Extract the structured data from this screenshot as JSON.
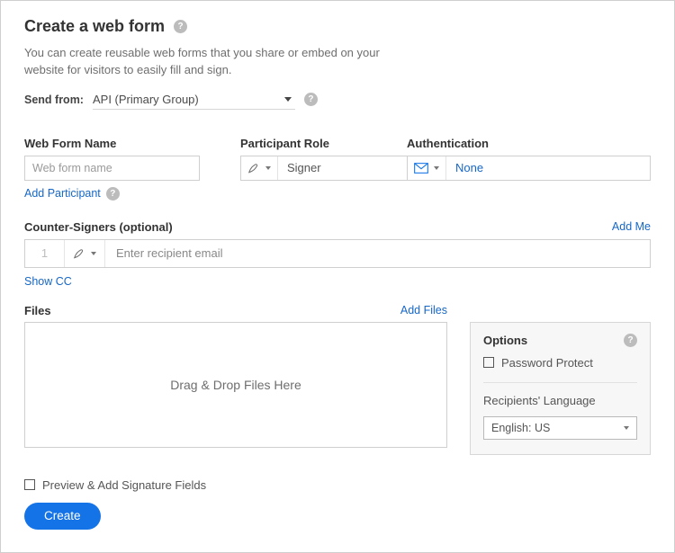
{
  "header": {
    "title": "Create a web form",
    "subtitle": "You can create reusable web forms that you share or embed on your website for visitors to easily fill and sign."
  },
  "sendFrom": {
    "label": "Send from:",
    "value": "API (Primary Group)"
  },
  "fields": {
    "webFormName": {
      "label": "Web Form Name",
      "placeholder": "Web form name"
    },
    "participantRole": {
      "label": "Participant Role",
      "value": "Signer"
    },
    "authentication": {
      "label": "Authentication",
      "value": "None"
    }
  },
  "addParticipant": "Add Participant",
  "counterSigners": {
    "label": "Counter-Signers (optional)",
    "addMe": "Add Me",
    "index": "1",
    "placeholder": "Enter recipient email"
  },
  "showCC": "Show CC",
  "files": {
    "label": "Files",
    "addFiles": "Add Files",
    "dropText": "Drag & Drop Files Here"
  },
  "options": {
    "title": "Options",
    "passwordProtect": "Password Protect",
    "recipientsLanguageLabel": "Recipients' Language",
    "languageValue": "English: US"
  },
  "previewCheck": "Preview & Add Signature Fields",
  "createButton": "Create"
}
